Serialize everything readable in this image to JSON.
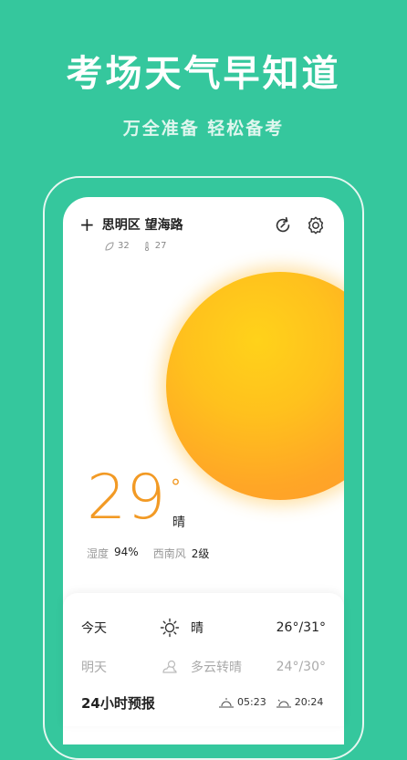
{
  "promo": {
    "headline": "考场天气早知道",
    "subline": "万全准备 轻松备考"
  },
  "header": {
    "location": "思明区 望海路",
    "aqi_value": "32",
    "feels_value": "27",
    "icons": [
      "plus-icon",
      "refresh-icon",
      "gear-icon",
      "leaf-icon",
      "thermometer-icon"
    ]
  },
  "current": {
    "temperature": "29",
    "degree_symbol": "°",
    "condition": "晴",
    "humidity_label": "湿度",
    "humidity_value": "94%",
    "wind_label": "西南风",
    "wind_value": "2级"
  },
  "daily": [
    {
      "day": "今天",
      "icon": "sun-icon",
      "condition": "晴",
      "range": "26°/31°"
    },
    {
      "day": "明天",
      "icon": "partly-cloudy-icon",
      "condition": "多云转晴",
      "range": "24°/30°"
    }
  ],
  "hourly": {
    "title": "24小时预报",
    "sunrise": "05:23",
    "sunset": "20:24"
  },
  "colors": {
    "background": "#35c79d",
    "temperature": "#f29a25",
    "sun": "#ffc11d"
  }
}
